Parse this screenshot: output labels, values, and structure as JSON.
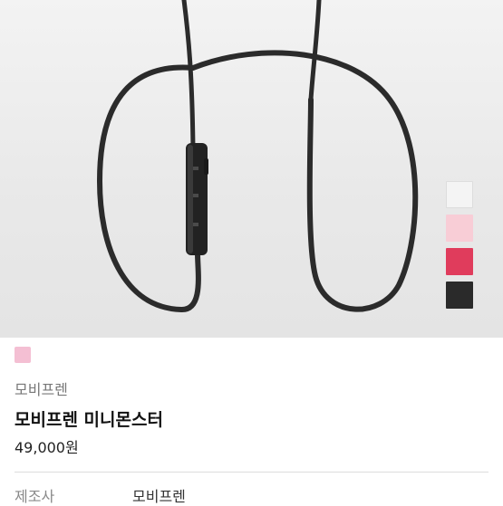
{
  "product": {
    "brand": "모비프렌",
    "name": "모비프렌 미니몬스터",
    "price": "49,000원",
    "selected_color": "#f4bfd3",
    "colors": [
      "#f4f4f4",
      "#f8cdd6",
      "#e03c5c",
      "#2a2a2a"
    ]
  },
  "specs": [
    {
      "label": "제조사",
      "value": "모비프렌"
    }
  ]
}
